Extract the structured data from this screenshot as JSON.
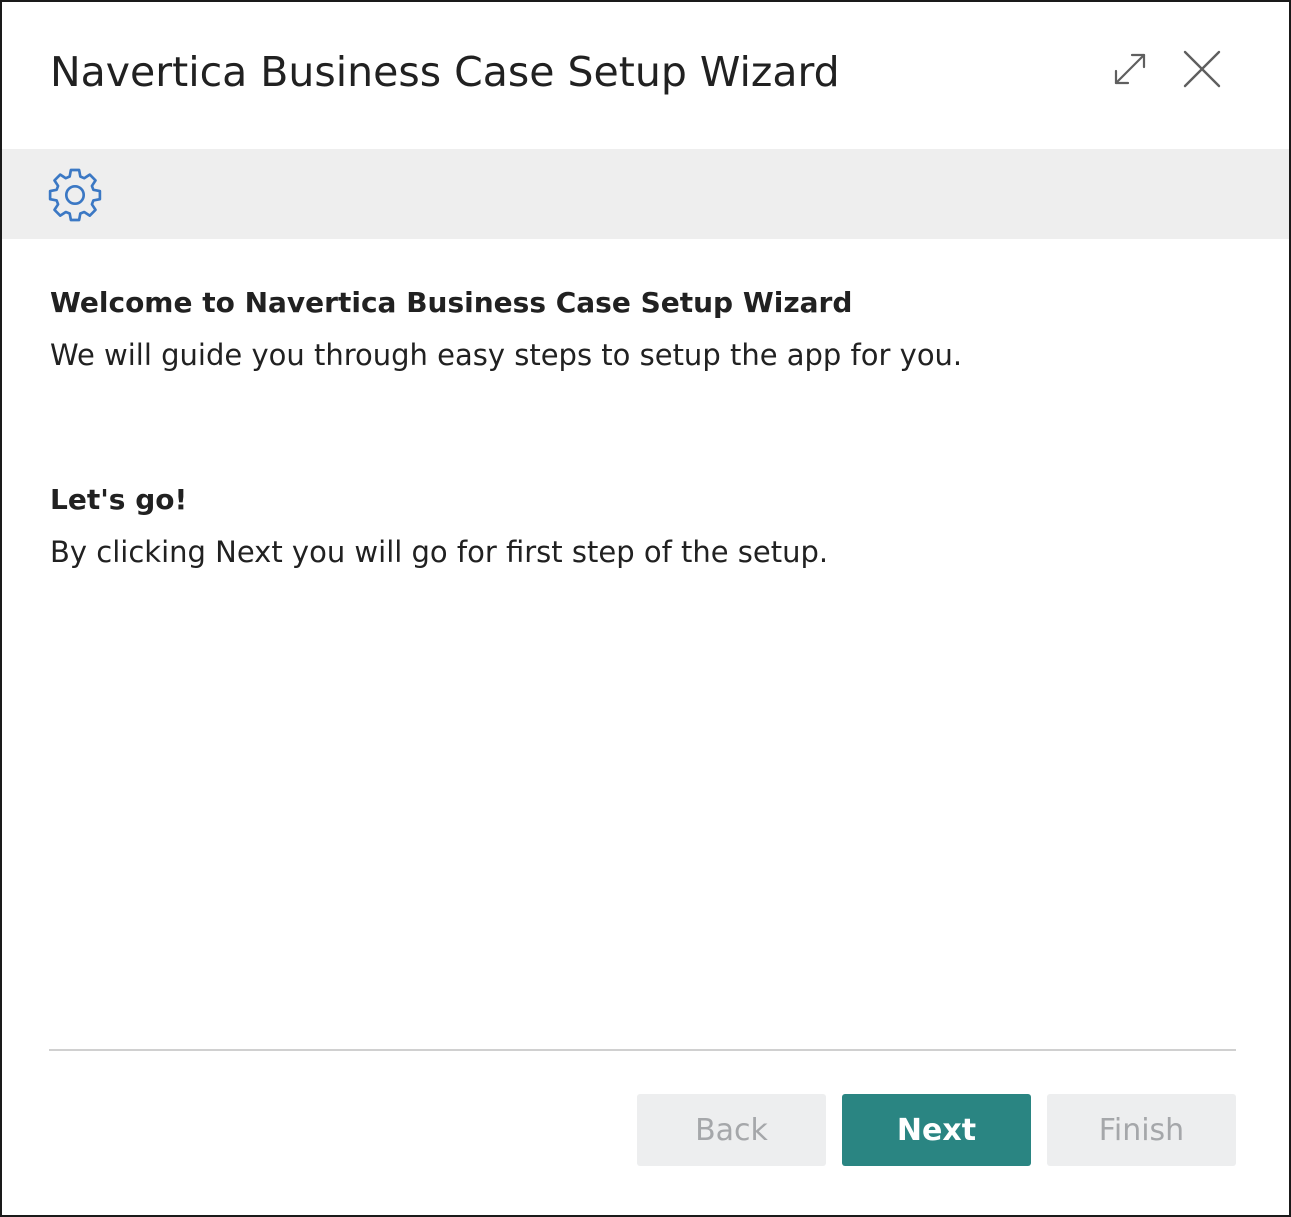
{
  "dialog": {
    "title": "Navertica Business Case Setup Wizard",
    "accent_color": "#2a8582",
    "gear_icon_color": "#3b78c4"
  },
  "header_icons": [
    "expand-icon",
    "close-icon"
  ],
  "banner": {
    "icon": "gear-icon"
  },
  "welcome": {
    "heading": "Welcome to Navertica Business Case Setup Wizard",
    "text": "We will guide you through easy steps to setup the app for you."
  },
  "lets_go": {
    "heading": "Let's go!",
    "text": "By clicking Next you will go for first step of the setup."
  },
  "footer": {
    "back_label": "Back",
    "next_label": "Next",
    "finish_label": "Finish"
  }
}
